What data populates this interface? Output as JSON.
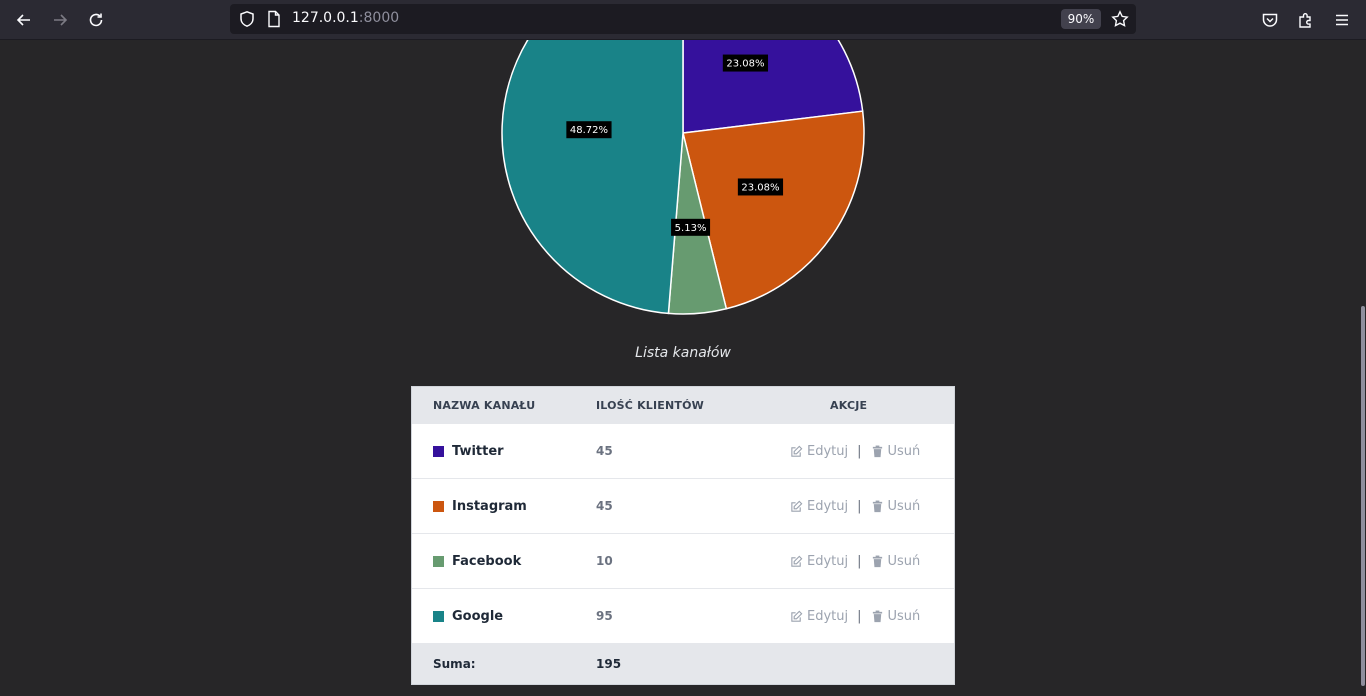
{
  "browser": {
    "url_host": "127.0.0.1",
    "url_port": ":8000",
    "zoom": "90%"
  },
  "caption": "Lista kanałów",
  "chart_data": {
    "type": "pie",
    "categories": [
      "Twitter",
      "Instagram",
      "Facebook",
      "Google"
    ],
    "values": [
      45,
      45,
      10,
      95
    ],
    "colors": [
      "#35119c",
      "#cc560f",
      "#679b70",
      "#198388"
    ],
    "data_labels": [
      "23.08%",
      "23.08%",
      "5.13%",
      "48.72%"
    ]
  },
  "table": {
    "headers": [
      "NAZWA KANAŁU",
      "ILOŚĆ KLIENTÓW",
      "AKCJE"
    ],
    "rows": [
      {
        "name": "Twitter",
        "count": "45",
        "color": "#35119c",
        "edit": "Edytuj",
        "delete": "Usuń"
      },
      {
        "name": "Instagram",
        "count": "45",
        "color": "#cc560f",
        "edit": "Edytuj",
        "delete": "Usuń"
      },
      {
        "name": "Facebook",
        "count": "10",
        "color": "#679b70",
        "edit": "Edytuj",
        "delete": "Usuń"
      },
      {
        "name": "Google",
        "count": "95",
        "color": "#198388",
        "edit": "Edytuj",
        "delete": "Usuń"
      }
    ],
    "footer_label": "Suma:",
    "footer_sum": "195"
  },
  "icons": {
    "back": "arrow-left-icon",
    "forward": "arrow-right-icon",
    "reload": "reload-icon",
    "shield": "shield-icon",
    "page": "page-icon",
    "star": "star-icon",
    "pocket": "pocket-icon",
    "extensions": "puzzle-icon",
    "menu": "hamburger-menu-icon",
    "edit": "edit-icon",
    "delete": "trash-icon"
  }
}
